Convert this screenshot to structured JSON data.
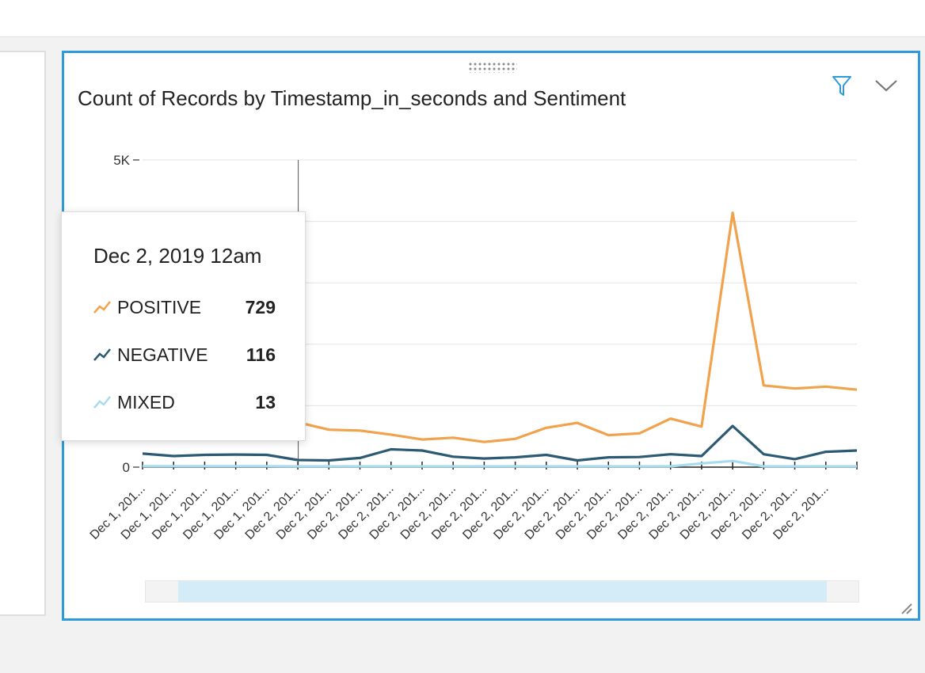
{
  "visual": {
    "title": "Count of Records by Timestamp_in_seconds and Sentiment"
  },
  "icons": {
    "drag": "drag-handle-icon",
    "filter": "filter-icon",
    "menu": "chevron-down-icon",
    "resize": "resize-handle-icon"
  },
  "colors": {
    "accent": "#2e9bd8",
    "positive": "#f0a24c",
    "negative": "#2c5a73",
    "mixed": "#a7dcef"
  },
  "chart_data": {
    "type": "line",
    "title": "Count of Records by Timestamp_in_seconds and Sentiment",
    "xlabel": "",
    "ylabel": "",
    "ylim": [
      0,
      5000
    ],
    "yticks": [
      {
        "value": 0,
        "label": "0"
      },
      {
        "value": 5000,
        "label": "5K"
      }
    ],
    "gridlines": [
      1000,
      2000,
      3000,
      4000,
      5000
    ],
    "grid": true,
    "categories": [
      "Dec 1, 201...",
      "Dec 1, 201...",
      "Dec 1, 201...",
      "Dec 1, 201...",
      "Dec 1, 201...",
      "Dec 2, 201...",
      "Dec 2, 201...",
      "Dec 2, 201...",
      "Dec 2, 201...",
      "Dec 2, 201...",
      "Dec 2, 201...",
      "Dec 2, 201...",
      "Dec 2, 201...",
      "Dec 2, 201...",
      "Dec 2, 201...",
      "Dec 2, 201...",
      "Dec 2, 201...",
      "Dec 2, 201...",
      "Dec 2, 201...",
      "Dec 2, 201...",
      "Dec 2, 201...",
      "Dec 2, 201...",
      "Dec 2, 201..."
    ],
    "series": [
      {
        "name": "POSITIVE",
        "color": "#f0a24c",
        "values": [
          720,
          710,
          720,
          730,
          725,
          729,
          610,
          595,
          530,
          450,
          480,
          410,
          460,
          640,
          720,
          520,
          550,
          790,
          660,
          4140,
          1330,
          1280,
          1310,
          1260
        ]
      },
      {
        "name": "NEGATIVE",
        "color": "#2c5a73",
        "values": [
          220,
          180,
          200,
          205,
          200,
          116,
          110,
          150,
          290,
          270,
          170,
          140,
          160,
          200,
          110,
          160,
          165,
          210,
          180,
          670,
          210,
          130,
          250,
          270
        ]
      },
      {
        "name": "MIXED",
        "color": "#a7dcef",
        "values": [
          15,
          15,
          15,
          15,
          15,
          13,
          13,
          13,
          13,
          13,
          13,
          13,
          13,
          13,
          13,
          13,
          13,
          13,
          60,
          100,
          13,
          13,
          13,
          13
        ]
      }
    ],
    "tooltip": {
      "title": "Dec 2, 2019 12am",
      "rows": [
        {
          "name": "POSITIVE",
          "value": "729"
        },
        {
          "name": "NEGATIVE",
          "value": "116"
        },
        {
          "name": "MIXED",
          "value": "13"
        }
      ]
    },
    "scrollbar": {
      "start": 0.045,
      "end": 0.955
    }
  }
}
